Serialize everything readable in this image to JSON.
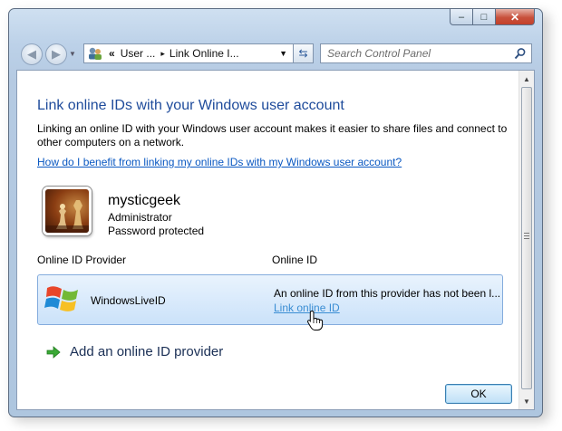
{
  "window": {
    "minimize_label": "–",
    "maximize_label": "□",
    "close_label": "✕"
  },
  "nav": {
    "back_icon": "back-arrow-icon",
    "forward_icon": "forward-arrow-icon",
    "breadcrumb": {
      "prefix": "«",
      "part1": "User ...",
      "separator": "▸",
      "part2": "Link Online I..."
    },
    "search_placeholder": "Search Control Panel"
  },
  "content": {
    "heading": "Link online IDs with your Windows user account",
    "description": "Linking an online ID with your Windows user account makes it easier to share files and connect to other computers on a network.",
    "help_link": "How do I benefit from linking my online IDs with my Windows user account?",
    "user": {
      "name": "mysticgeek",
      "role": "Administrator",
      "protection": "Password protected"
    },
    "columns": {
      "provider": "Online ID Provider",
      "online_id": "Online ID"
    },
    "providers": [
      {
        "name": "WindowsLiveID",
        "status": "An online ID from this provider has not been l...",
        "link_label": "Link online ID"
      }
    ],
    "add_provider": "Add an online ID provider",
    "ok_button": "OK"
  },
  "colors": {
    "heading": "#1e4b9b",
    "link": "#0a58c2",
    "row_selected": "#cbe2fa",
    "frame": "#bcd1e8"
  }
}
